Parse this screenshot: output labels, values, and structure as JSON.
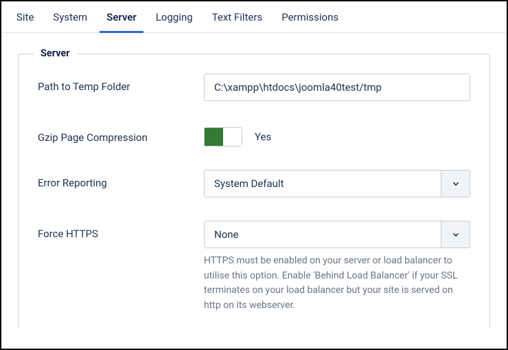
{
  "tabs": {
    "items": [
      {
        "label": "Site",
        "active": false
      },
      {
        "label": "System",
        "active": false
      },
      {
        "label": "Server",
        "active": true
      },
      {
        "label": "Logging",
        "active": false
      },
      {
        "label": "Text Filters",
        "active": false
      },
      {
        "label": "Permissions",
        "active": false
      }
    ]
  },
  "legend": "Server",
  "fields": {
    "tmp_path": {
      "label": "Path to Temp Folder",
      "value": "C:\\xampp\\htdocs\\joomla40test/tmp"
    },
    "gzip": {
      "label": "Gzip Page Compression",
      "state_label": "Yes",
      "enabled": true
    },
    "error_reporting": {
      "label": "Error Reporting",
      "value": "System Default"
    },
    "force_https": {
      "label": "Force HTTPS",
      "value": "None",
      "help": "HTTPS must be enabled on your server or load balancer to utilise this option. Enable 'Behind Load Balancer' if your SSL terminates on your load balancer but your site is served on http on its webserver."
    }
  }
}
